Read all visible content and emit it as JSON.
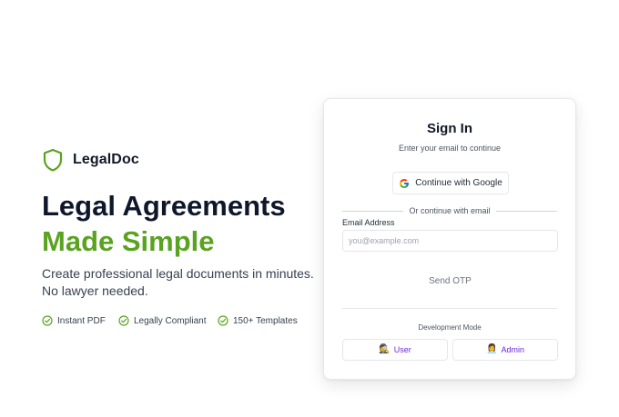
{
  "brand": {
    "name": "LegalDoc",
    "icon": "shield-icon",
    "accent_color": "#5aa321"
  },
  "hero": {
    "headline_line1": "Legal Agreements",
    "headline_line2": "Made Simple",
    "subtext_line1": "Create professional legal documents in minutes.",
    "subtext_line2": "No lawyer needed."
  },
  "features": [
    {
      "label": "Instant PDF",
      "icon": "check-circle-icon"
    },
    {
      "label": "Legally Compliant",
      "icon": "check-circle-icon"
    },
    {
      "label": "150+ Templates",
      "icon": "check-circle-icon"
    }
  ],
  "signin": {
    "title": "Sign In",
    "subtitle": "Enter your email to continue",
    "google_label": "Continue with Google",
    "divider_text": "Or continue with email",
    "email_label": "Email Address",
    "email_placeholder": "you@example.com",
    "email_value": "",
    "send_otp_label": "Send OTP",
    "dev_mode_label": "Development Mode",
    "user_label": "User",
    "user_emoji": "🕵️",
    "admin_label": "Admin",
    "admin_emoji": "👩‍💼",
    "dev_link_color": "#6d28d9"
  }
}
